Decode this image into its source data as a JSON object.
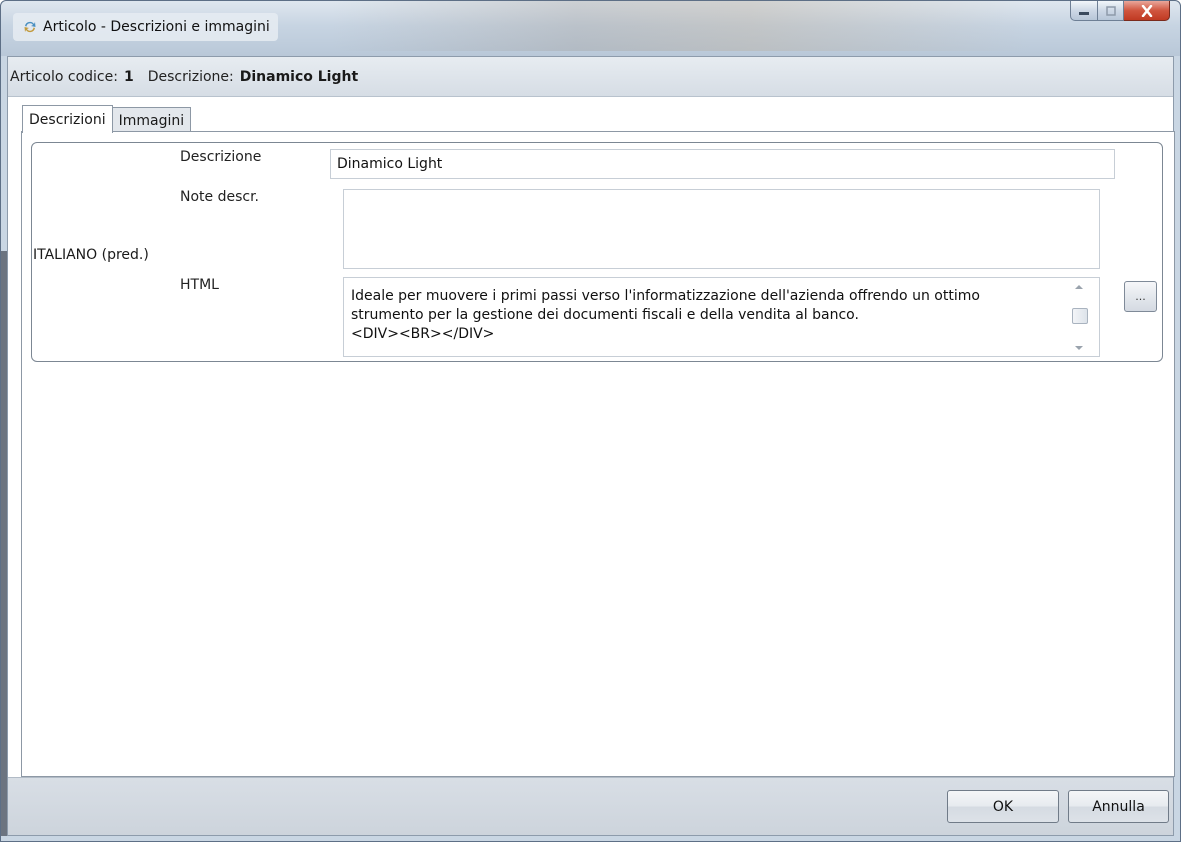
{
  "window": {
    "title": "Articolo - Descrizioni e immagini",
    "app_icon": "refresh-arrows-icon",
    "controls": {
      "minimize": "minimize-icon",
      "maximize": "maximize-icon",
      "close": "close-icon"
    },
    "colors": {
      "frame": "#c9d6e3",
      "close_button": "#c9452e"
    }
  },
  "info": {
    "code_label": "Articolo codice:",
    "code_value": "1",
    "desc_label": "Descrizione:",
    "desc_value": "Dinamico Light"
  },
  "tabs": [
    {
      "label": "Descrizioni",
      "active": true
    },
    {
      "label": "Immagini",
      "active": false
    }
  ],
  "language_group": {
    "language": "ITALIANO (pred.)",
    "fields": {
      "descrizione": {
        "label": "Descrizione",
        "value": "Dinamico Light"
      },
      "note": {
        "label": "Note descr.",
        "value": ""
      },
      "html": {
        "label": "HTML",
        "lines": [
          "Ideale per muovere i primi passi verso l'informatizzazione dell'azienda offrendo un ottimo",
          "strumento per la gestione dei documenti fiscali e della vendita al banco.",
          "<DIV><BR></DIV>"
        ],
        "edit_button": "..."
      }
    }
  },
  "footer": {
    "ok": "OK",
    "cancel": "Annulla"
  }
}
